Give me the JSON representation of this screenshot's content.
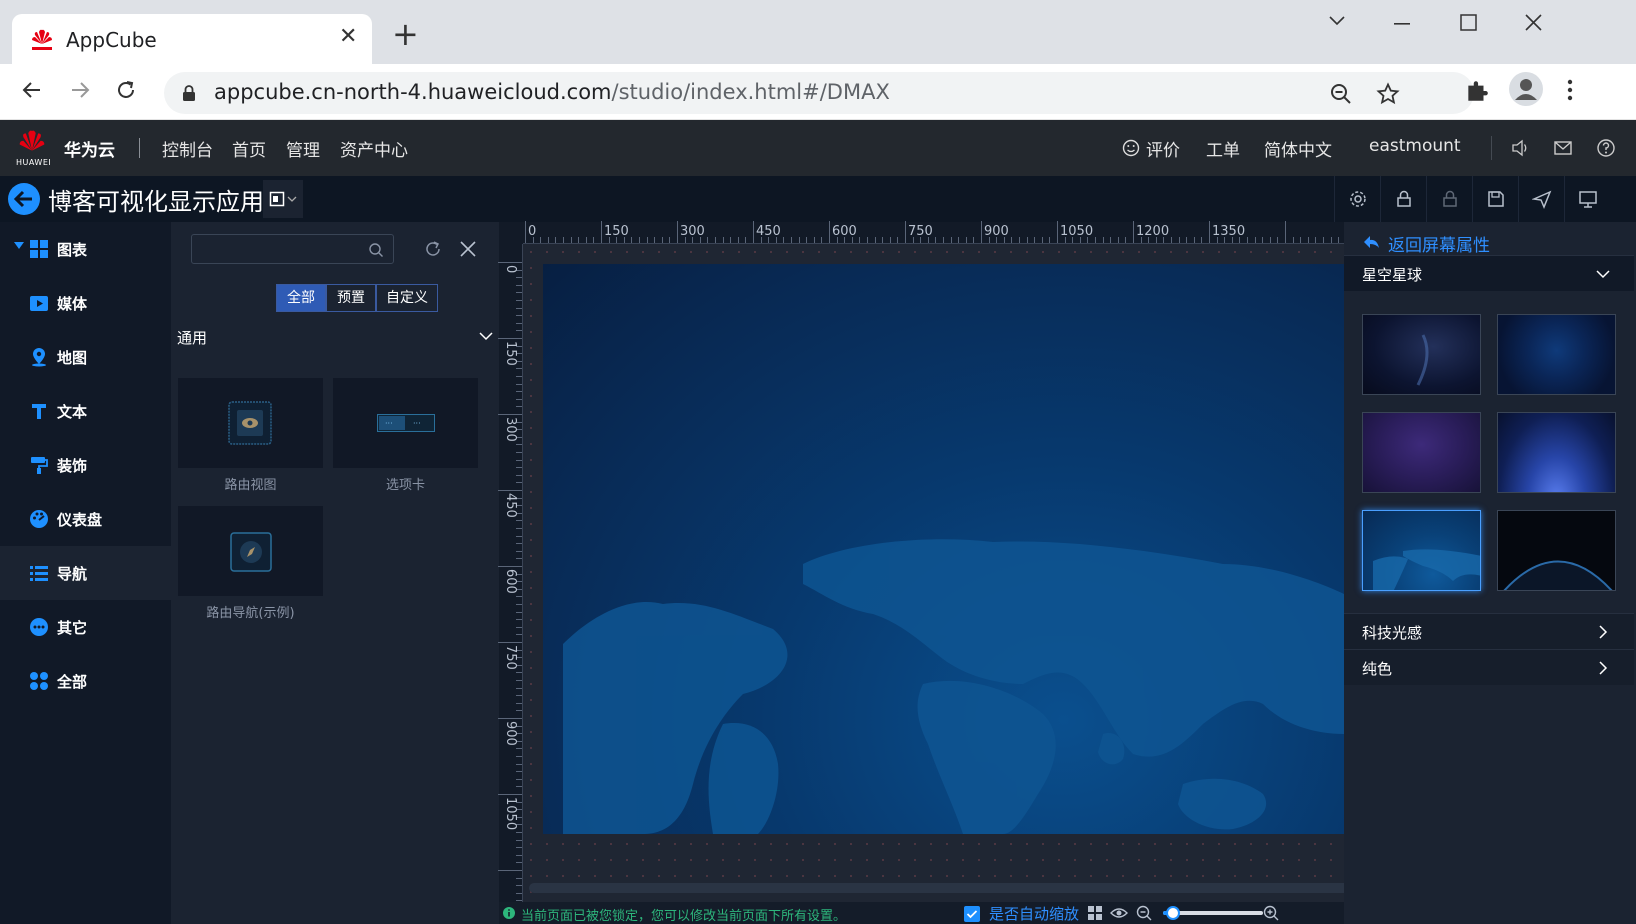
{
  "browser": {
    "tab_title": "AppCube",
    "url_host": "appcube.cn-north-4.huaweicloud.com",
    "url_path": "/studio/index.html#/DMAX"
  },
  "header": {
    "logo_text": "HUAWEI",
    "brand": "华为云",
    "nav": [
      "控制台",
      "首页",
      "管理",
      "资产中心"
    ],
    "right": {
      "rate": "评价",
      "ticket": "工单",
      "language": "简体中文",
      "user": "eastmount"
    }
  },
  "studio": {
    "title": "博客可视化显示应用"
  },
  "leftnav": {
    "items": [
      {
        "label": "图表",
        "icon": "grid-icon"
      },
      {
        "label": "媒体",
        "icon": "media-icon"
      },
      {
        "label": "地图",
        "icon": "map-pin-icon"
      },
      {
        "label": "文本",
        "icon": "text-icon"
      },
      {
        "label": "装饰",
        "icon": "paint-roller-icon"
      },
      {
        "label": "仪表盘",
        "icon": "dashboard-icon"
      },
      {
        "label": "导航",
        "icon": "list-icon"
      },
      {
        "label": "其它",
        "icon": "more-icon"
      },
      {
        "label": "全部",
        "icon": "all-icon"
      }
    ],
    "active": "导航"
  },
  "components": {
    "search_placeholder": "",
    "filters": [
      "全部",
      "预置",
      "自定义"
    ],
    "active_filter": "全部",
    "group": "通用",
    "items": [
      "路由视图",
      "选项卡",
      "路由导航(示例)"
    ]
  },
  "ruler": {
    "x_ticks": [
      "0",
      "150",
      "300",
      "450",
      "600",
      "750",
      "900",
      "1050",
      "1200",
      "1350"
    ],
    "y_ticks": [
      "0",
      "150",
      "300",
      "450",
      "600",
      "750",
      "900",
      "1050"
    ]
  },
  "status": {
    "message": "当前页面已被您锁定，您可以修改当前页面下所有设置。",
    "auto_zoom": "是否自动缩放",
    "zoom_level": 0.1
  },
  "rightpanel": {
    "back_label": "返回屏幕属性",
    "sections": [
      "星空星球",
      "科技光感",
      "纯色"
    ],
    "selected_thumb": 4
  },
  "colors": {
    "accent": "#1e90ff",
    "status_text": "#2db67c",
    "link": "#2f8fff"
  }
}
